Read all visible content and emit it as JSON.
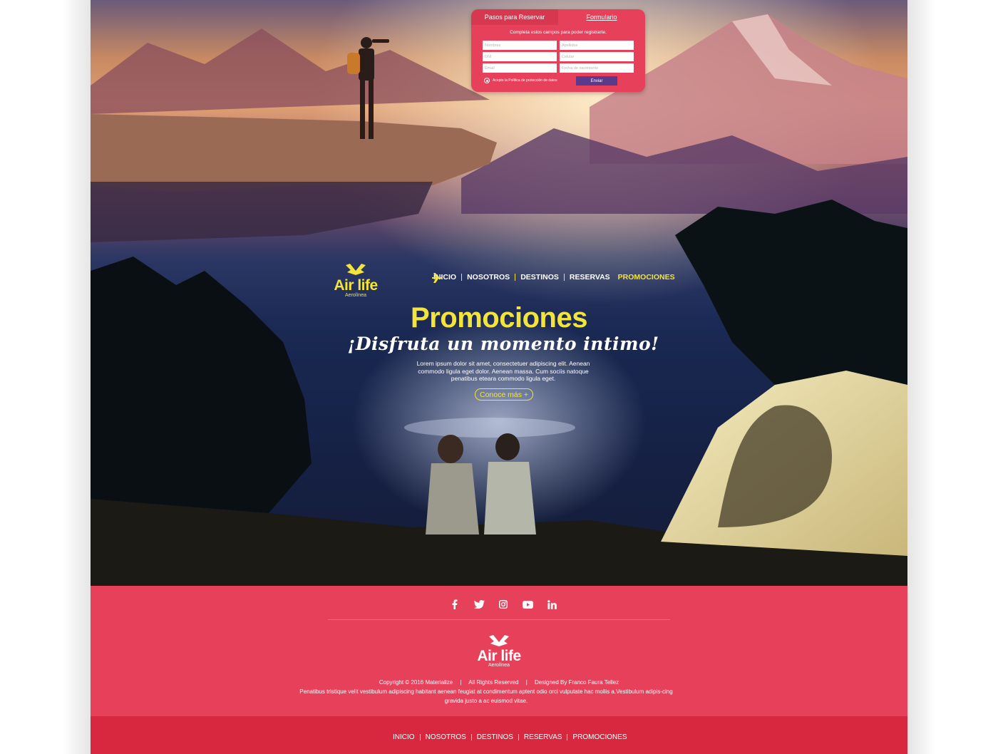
{
  "form": {
    "tabs": [
      "Pasos para Reservar",
      "Formulario"
    ],
    "instructions": "Completa estos campos para poder registrarte.",
    "fields": {
      "nombres": "Nombres",
      "apellidos": "Apellidos",
      "dni": "DNI",
      "celular": "Celular",
      "email": "Email",
      "fecha": "Fecha de nacimiento"
    },
    "consent": "Acepto la Política de protección de datos",
    "submit": "Enviar"
  },
  "brand": {
    "name": "Air life",
    "subtitle": "Aerolínea",
    "accent_color": "#f3e43b",
    "footer_color": "#e6405b"
  },
  "nav": {
    "items": [
      "INICIO",
      "NOSOTROS",
      "DESTINOS",
      "RESERVAS",
      "PROMOCIONES"
    ],
    "active": "PROMOCIONES"
  },
  "hero": {
    "title": "Promociones",
    "subtitle": "¡Disfruta un momento intimo!",
    "body": "Lorem ipsum dolor sit amet, consectetuer adipiscing elit. Aenean commodo ligula eget dolor. Aenean massa. Cum sociis natoque penatibus eteara commodo ligula eget.",
    "cta": "Conoce más +"
  },
  "footer": {
    "socials": [
      "facebook-icon",
      "twitter-icon",
      "instagram-icon",
      "youtube-icon",
      "linkedin-icon"
    ],
    "copyright": "Copyright © 2016 Materialize",
    "rights": "All Rights Reserved",
    "designer": "Designed By Franco Faura Tellez",
    "lorem": "Penatibus tristique velit vestibulum adipiscing habitant aenean feugiat at condimentum aptent odio orci vulputate hac mollis a.Vestibulum adipis-cing gravida justo a ac euismod vitae.",
    "nav": [
      "INICIO",
      "NOSOTROS",
      "DESTINOS",
      "RESERVAS",
      "PROMOCIONES"
    ]
  }
}
